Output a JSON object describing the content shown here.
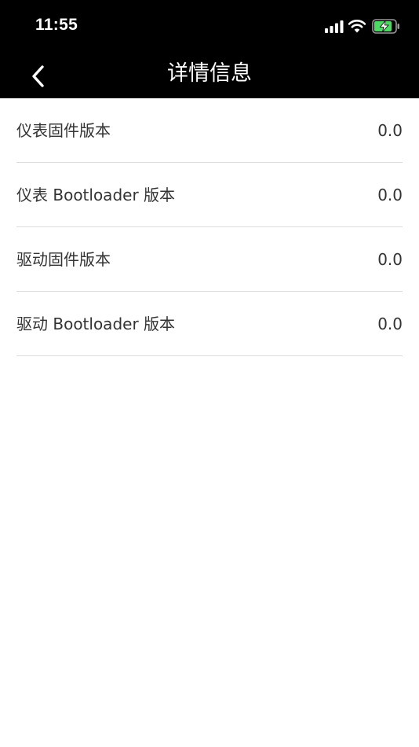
{
  "status_bar": {
    "time": "11:55"
  },
  "nav": {
    "title": "详情信息",
    "back_icon": "chevron-left-icon"
  },
  "details": [
    {
      "label": "仪表固件版本",
      "value": "0.0"
    },
    {
      "label": "仪表 Bootloader 版本",
      "value": "0.0"
    },
    {
      "label": "驱动固件版本",
      "value": "0.0"
    },
    {
      "label": "驱动 Bootloader 版本",
      "value": "0.0"
    }
  ],
  "colors": {
    "header_background": "#000000",
    "header_text": "#ffffff",
    "battery_fill": "#4cd964",
    "body_text": "#333333",
    "divider": "#dcdcdc"
  }
}
